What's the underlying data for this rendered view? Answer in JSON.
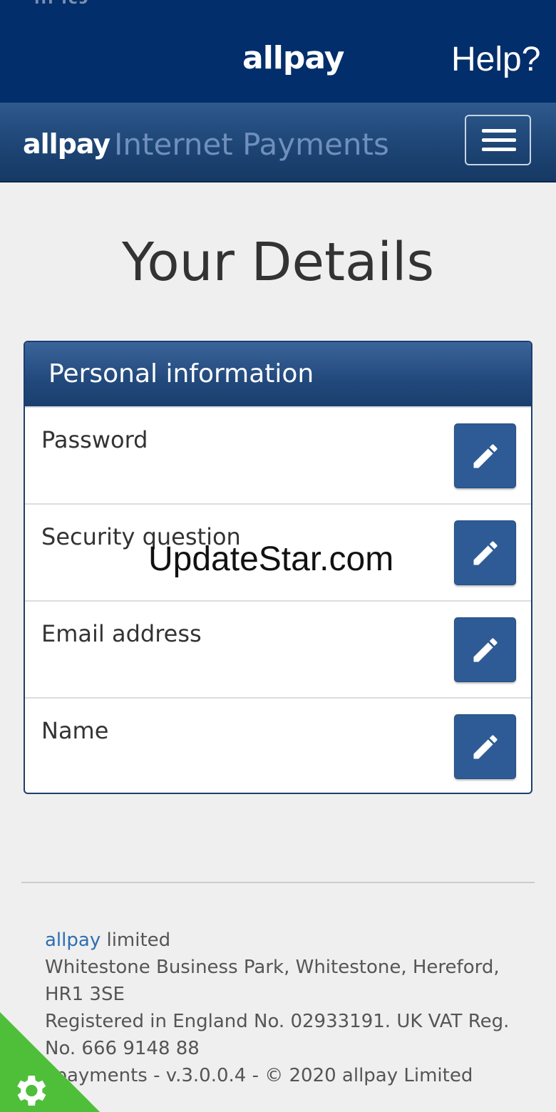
{
  "statusbar": {
    "left_fragment": "ııı ıcɔ"
  },
  "header": {
    "logo": "allpay",
    "help_label": "Help?"
  },
  "navbar": {
    "logo": "allpay",
    "title": "Internet Payments"
  },
  "main": {
    "page_title": "Your Details",
    "panel": {
      "heading": "Personal information",
      "rows": [
        {
          "label": "Password"
        },
        {
          "label": "Security question"
        },
        {
          "label": "Email address"
        },
        {
          "label": "Name"
        }
      ]
    }
  },
  "watermark": "UpdateStar.com",
  "footer": {
    "company_link": "allpay",
    "company_suffix": " limited",
    "address_line": "Whitestone Business Park, Whitestone, Hereford, HR1 3SE",
    "registration": "Registered in England No. 02933191. UK VAT Reg. No. 666 9148 88",
    "version": "llpayments - v.3.0.0.4 - © 2020 allpay Limited"
  },
  "colors": {
    "header_bg": "#022e6b",
    "button_bg": "#2e5b95",
    "link": "#2f6eb0",
    "corner_badge": "#4fbf3a"
  },
  "icons": {
    "edit": "pencil-icon",
    "menu": "hamburger-icon",
    "badge": "gear-icon"
  }
}
